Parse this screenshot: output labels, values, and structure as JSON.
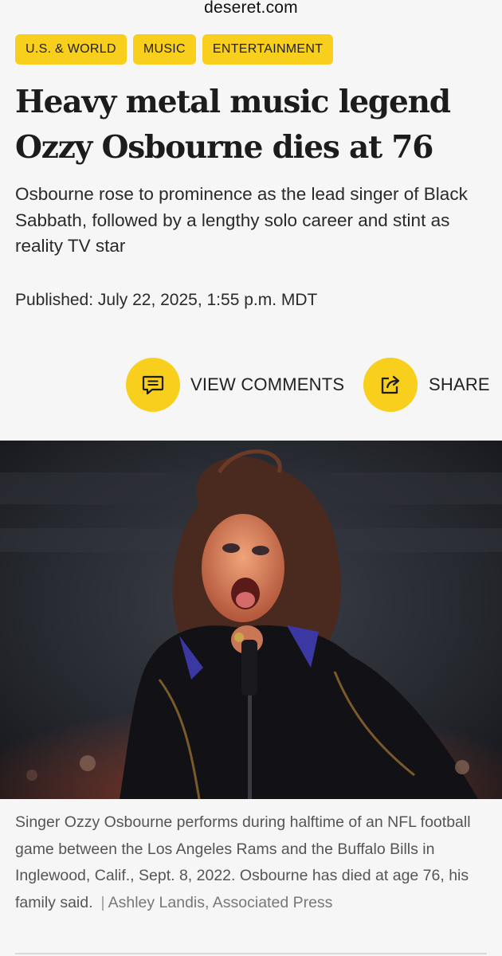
{
  "browser": {
    "url": "deseret.com"
  },
  "tags": [
    "U.S. & WORLD",
    "MUSIC",
    "ENTERTAINMENT"
  ],
  "article": {
    "headline_line1": "Heavy metal music legend",
    "headline_line2": "Ozzy Osbourne dies at 76",
    "dek": "Osbourne rose to prominence as the lead singer of Black Sabbath, followed by a lengthy solo career and stint as reality TV star",
    "published": "Published: July 22, 2025, 1:55 p.m. MDT"
  },
  "actions": {
    "comments_label": "VIEW COMMENTS",
    "share_label": "SHARE",
    "comments_icon": "comment-icon",
    "share_icon": "share-icon"
  },
  "photo": {
    "caption": "Singer Ozzy Osbourne performs during halftime of an NFL football game between the Los Angeles Rams and the Buffalo Bills in Inglewood, Calif., Sept. 8, 2022. Osbourne has died at age 76, his family said.",
    "separator": "|",
    "credit": "Ashley Landis, Associated Press"
  },
  "colors": {
    "accent": "#f8cf1c",
    "background": "#f6f6f6",
    "text": "#1c1c1c"
  }
}
